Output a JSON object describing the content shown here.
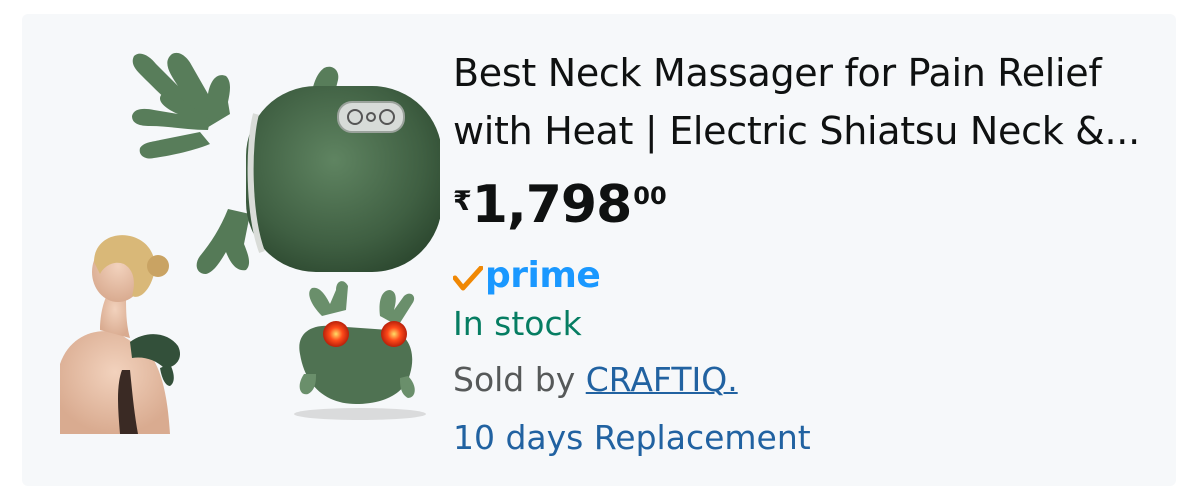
{
  "product": {
    "title_line1": "Best Neck Massager for Pain Relief",
    "title_line2": "with Heat | Electric Shiatsu Neck &...",
    "price": {
      "currency_symbol": "₹",
      "whole": "1,798",
      "fraction": "00"
    },
    "prime_label": "prime",
    "prime_check_icon": "check-icon",
    "stock_status": "In stock",
    "sold_by_label": "Sold by",
    "seller_name": "CRAFTIQ.",
    "replacement_policy": "10 days Replacement",
    "image": "neck-massager-product-image"
  },
  "colors": {
    "card_background": "#f6f8fa",
    "title": "#0f1111",
    "prime_blue": "#1a98ff",
    "prime_check_orange": "#f08804",
    "stock_green": "#067d62",
    "link_blue": "#2162a1",
    "secondary_text": "#565959",
    "product_green": "#4a6b4c"
  }
}
